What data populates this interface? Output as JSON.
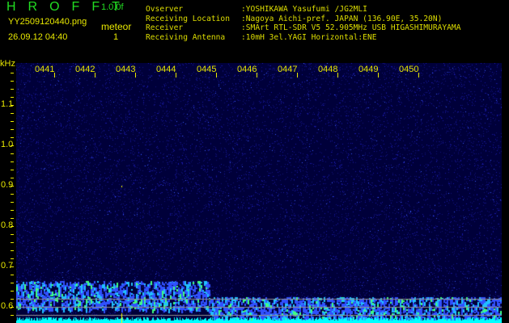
{
  "header": {
    "app_title": "HROFFT",
    "version": "1.0.0f",
    "filename": "YY2509120440.png",
    "datetime": "26.09.12 04:40",
    "event_label": "meteor",
    "event_count": "1"
  },
  "info": [
    {
      "label": "Ovserver",
      "value": ":YOSHIKAWA Yasufumi /JG2MLI"
    },
    {
      "label": "Receiving Location",
      "value": ":Nagoya Aichi-pref. JAPAN (136.90E, 35.20N)"
    },
    {
      "label": "Receiver",
      "value": ":SMArt RTL-SDR V5 52.905MHz USB HIGASHIMURAYAMA"
    },
    {
      "label": "Receiving Antenna",
      "value": ":10mH 3el.YAGI Horizontal:ENE"
    }
  ],
  "spectrogram": {
    "y_unit": "kHz",
    "time_labels": [
      "0441",
      "0442",
      "0443",
      "0444",
      "0445",
      "0446",
      "0447",
      "0448",
      "0449",
      "0450"
    ],
    "freq_labels": [
      "1.1",
      "1.0",
      "0.9",
      "0.8",
      "0.7",
      "0.6"
    ],
    "ylim_khz": [
      0.56,
      1.2
    ],
    "colors": {
      "background": "#000060",
      "label": "#e8e800",
      "title": "#22dd22",
      "baseline": "#00ffff"
    }
  }
}
